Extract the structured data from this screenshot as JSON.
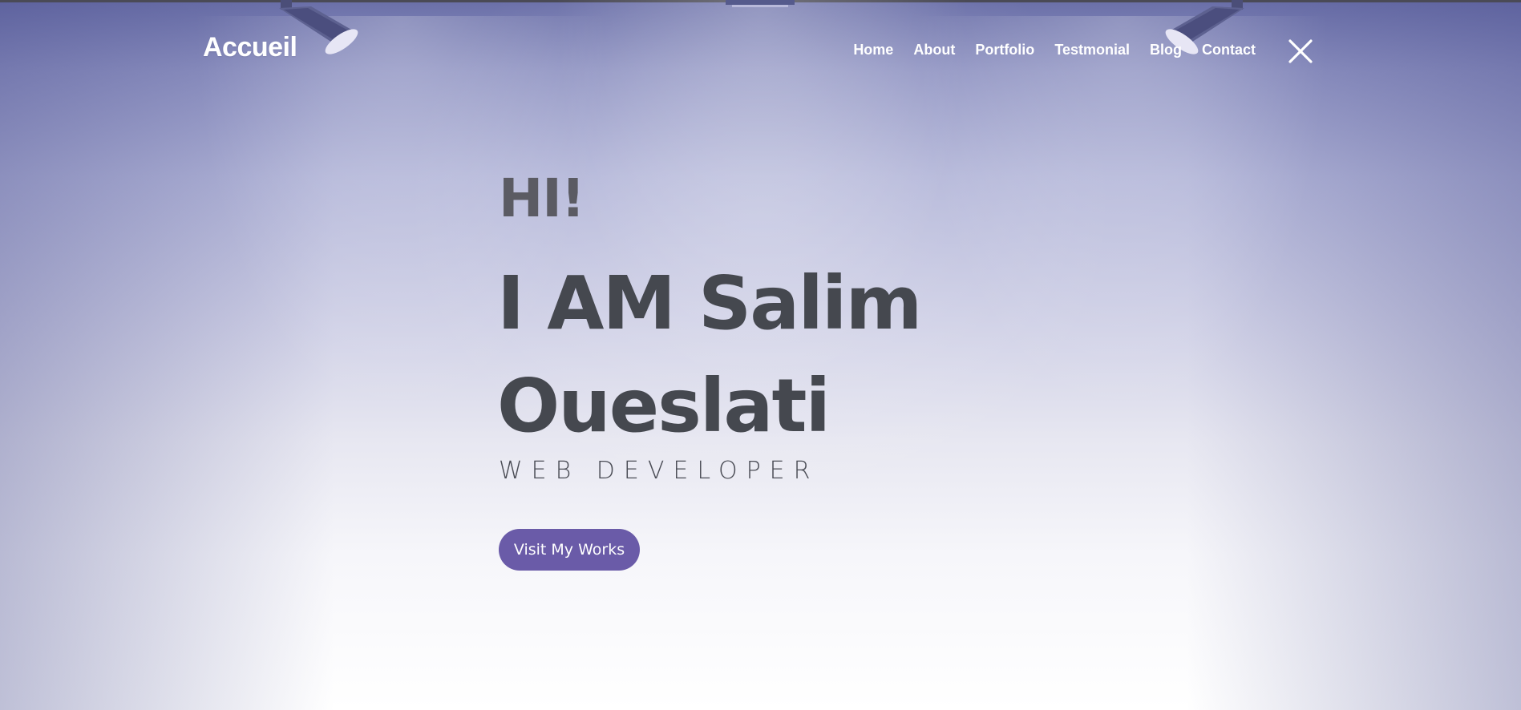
{
  "header": {
    "brand": "Accueil",
    "nav": [
      {
        "label": "Home"
      },
      {
        "label": "About"
      },
      {
        "label": "Portfolio"
      },
      {
        "label": "Testmonial"
      },
      {
        "label": "Blog"
      },
      {
        "label": "Contact"
      }
    ],
    "close_icon": "close-icon"
  },
  "hero": {
    "greeting": "HI!",
    "name": "I AM Salim Oueslati",
    "role": "WEB DEVELOPER",
    "cta_label": "Visit My Works"
  },
  "colors": {
    "accent": "#6a5ba8",
    "heading": "#45484f",
    "greeting": "#5b5b63",
    "nav_text": "#ffffff",
    "background_top": "#6a6fa8"
  }
}
